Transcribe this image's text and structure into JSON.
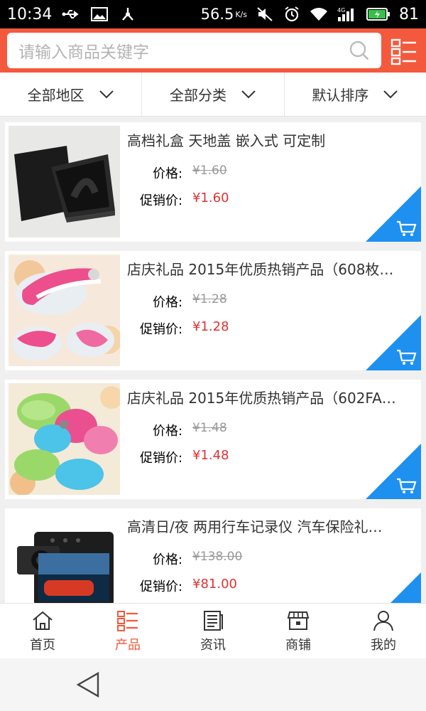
{
  "status_bar": {
    "time": "10:34",
    "speed": "56.5",
    "speed_unit": "K/s",
    "network": "4G",
    "battery": "81"
  },
  "search": {
    "placeholder": "请输入商品关键字"
  },
  "filters": [
    {
      "label": "全部地区"
    },
    {
      "label": "全部分类"
    },
    {
      "label": "默认排序"
    }
  ],
  "products": [
    {
      "title": "高档礼盒 天地盖 嵌入式 可定制",
      "price_label": "价格:",
      "price": "¥1.60",
      "promo_label": "促销价:",
      "promo_price": "¥1.60"
    },
    {
      "title": "店庆礼品 2015年优质热销产品（608枚…",
      "price_label": "价格:",
      "price": "¥1.28",
      "promo_label": "促销价:",
      "promo_price": "¥1.28"
    },
    {
      "title": "店庆礼品 2015年优质热销产品（602FA…",
      "price_label": "价格:",
      "price": "¥1.48",
      "promo_label": "促销价:",
      "promo_price": "¥1.48"
    },
    {
      "title": "高清日/夜 两用行车记录仪 汽车保险礼…",
      "price_label": "价格:",
      "price": "¥138.00",
      "promo_label": "促销价:",
      "promo_price": "¥81.00"
    }
  ],
  "bottom_nav": [
    {
      "label": "首页",
      "icon": "home-icon"
    },
    {
      "label": "产品",
      "icon": "list-icon",
      "active": true
    },
    {
      "label": "资讯",
      "icon": "news-icon"
    },
    {
      "label": "商铺",
      "icon": "store-icon"
    },
    {
      "label": "我的",
      "icon": "user-icon"
    }
  ],
  "colors": {
    "accent": "#f4593d",
    "cart_badge": "#1e90f0",
    "promo_price": "#e23131"
  }
}
